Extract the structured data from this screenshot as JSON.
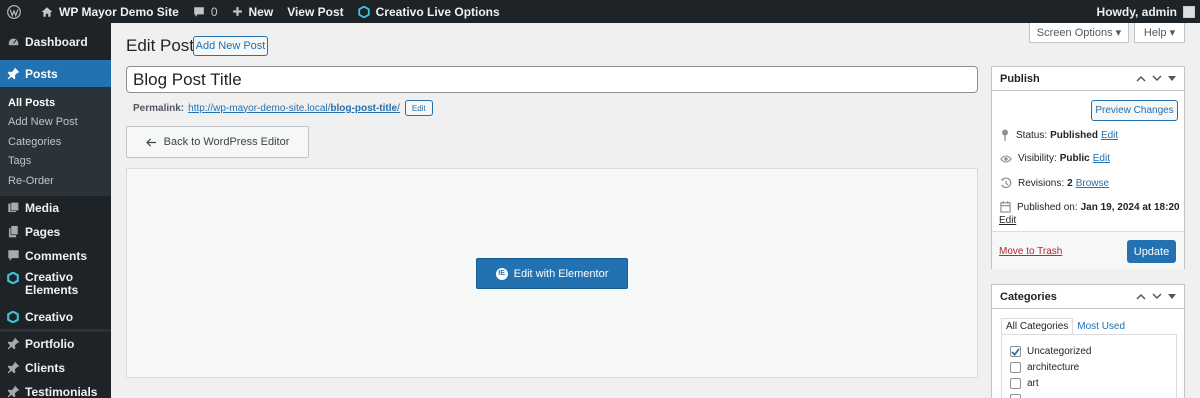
{
  "adminbar": {
    "site_name": "WP Mayor Demo Site",
    "comments_count": "0",
    "new_label": "New",
    "view_post_label": "View Post",
    "live_options_label": "Creativo Live Options",
    "howdy_label": "Howdy, admin"
  },
  "sidebar": {
    "dashboard": "Dashboard",
    "posts": "Posts",
    "submenu": [
      "All Posts",
      "Add New Post",
      "Categories",
      "Tags",
      "Re-Order"
    ],
    "media": "Media",
    "pages": "Pages",
    "comments": "Comments",
    "creativo_elements": "Creativo Elements",
    "creativo": "Creativo",
    "portfolio": "Portfolio",
    "clients": "Clients",
    "testimonials": "Testimonials"
  },
  "main": {
    "page_title": "Edit Post",
    "add_new_label": "Add New Post",
    "screen_options_label": "Screen Options ▾",
    "help_label": "Help ▾",
    "post_title": "Blog Post Title",
    "permalink_label": "Permalink:",
    "permalink_base": "http://wp-mayor-demo-site.local/",
    "permalink_slug": "blog-post-title",
    "permalink_trail": "/",
    "permalink_edit": "Edit",
    "back_label": "Back to WordPress Editor",
    "elementor_label": "Edit with Elementor",
    "elementor_logo": "IE"
  },
  "publish": {
    "title": "Publish",
    "preview_label": "Preview Changes",
    "status_label": "Status:",
    "status_value": "Published",
    "visibility_label": "Visibility:",
    "visibility_value": "Public",
    "revisions_label": "Revisions:",
    "revisions_value": "2",
    "browse_label": "Browse",
    "published_label": "Published on:",
    "published_value": "Jan 19, 2024 at 18:20",
    "edit_label": "Edit",
    "trash_label": "Move to Trash",
    "update_label": "Update"
  },
  "categories": {
    "title": "Categories",
    "tab_all": "All Categories",
    "tab_most": "Most Used",
    "items": [
      {
        "label": "Uncategorized",
        "checked": true
      },
      {
        "label": "architecture",
        "checked": false
      },
      {
        "label": "art",
        "checked": false
      }
    ]
  },
  "colors": {
    "admin_dark": "#1d2327",
    "accent": "#2271b1",
    "trash": "#b32d2e"
  }
}
